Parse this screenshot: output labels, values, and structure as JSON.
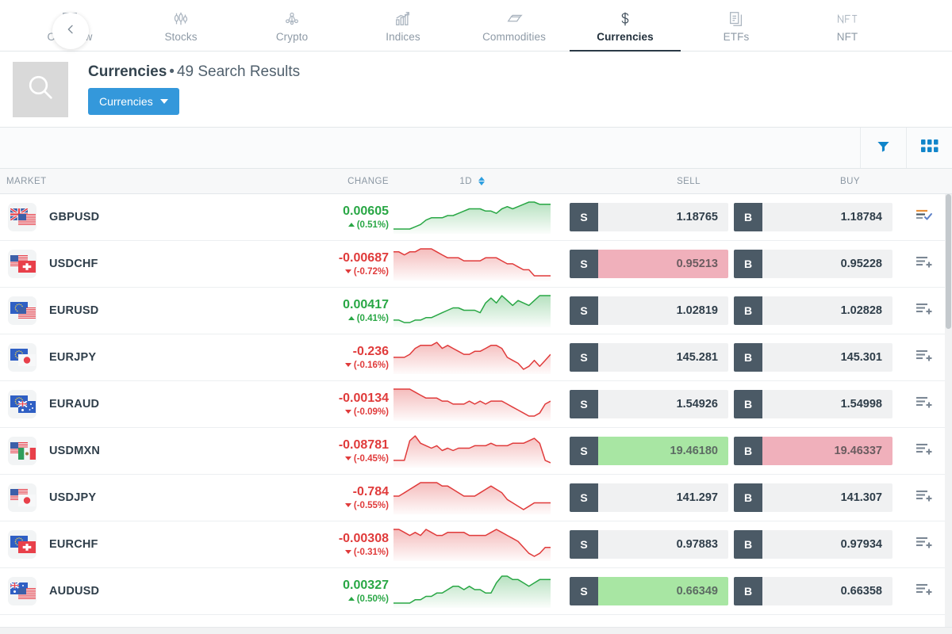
{
  "nav": {
    "back_icon": "chevron-left-icon",
    "tabs": [
      {
        "label": "Overview",
        "icon": "overview-icon",
        "active": false
      },
      {
        "label": "Stocks",
        "icon": "candlestick-icon",
        "active": false
      },
      {
        "label": "Crypto",
        "icon": "crypto-node-icon",
        "active": false
      },
      {
        "label": "Indices",
        "icon": "bar-chart-up-icon",
        "active": false
      },
      {
        "label": "Commodities",
        "icon": "gold-bar-icon",
        "active": false
      },
      {
        "label": "Currencies",
        "icon": "dollar-sign-icon",
        "active": true
      },
      {
        "label": "ETFs",
        "icon": "documents-icon",
        "active": false
      },
      {
        "label": "NFT",
        "icon": "nft-icon",
        "active": false
      }
    ]
  },
  "search": {
    "thumb_icon": "magnifier-icon",
    "title_category": "Currencies",
    "title_separator": "•",
    "title_results": "49 Search Results",
    "dropdown_label": "Currencies",
    "dropdown_icon": "caret-down-icon"
  },
  "toolbar": {
    "filter_icon": "funnel-filter-icon",
    "grid_icon": "grid-view-icon",
    "accent_color": "#1185ca"
  },
  "table": {
    "headers": {
      "market": "MARKET",
      "change": "CHANGE",
      "period": "1D",
      "sell": "SELL",
      "buy": "BUY"
    },
    "sell_tag": "S",
    "buy_tag": "B",
    "sort_icon": "sort-updown-icon",
    "rows": [
      {
        "market": "GBPUSD",
        "flag_a": "gb",
        "flag_b": "us",
        "change": "0.00605",
        "percent": "(0.51%)",
        "direction": "up",
        "spark_dir": "up",
        "spark": [
          14,
          14,
          14,
          14,
          13,
          12,
          10,
          9,
          9,
          9,
          8,
          8,
          7,
          6,
          5,
          5,
          5,
          6,
          6,
          7,
          5,
          4,
          5,
          4,
          3,
          2,
          2,
          3,
          3,
          3
        ],
        "sell": "1.18765",
        "sell_state": "none",
        "buy": "1.18784",
        "buy_state": "none",
        "action_icon": "watchlist-added-icon"
      },
      {
        "market": "USDCHF",
        "flag_a": "us",
        "flag_b": "ch",
        "change": "-0.00687",
        "percent": "(-0.72%)",
        "direction": "down",
        "spark_dir": "down",
        "spark": [
          4,
          4,
          5,
          4,
          4,
          3,
          3,
          3,
          4,
          5,
          6,
          6,
          6,
          7,
          7,
          7,
          7,
          6,
          6,
          6,
          7,
          8,
          8,
          9,
          10,
          10,
          12,
          12,
          12,
          12
        ],
        "sell": "0.95213",
        "sell_state": "red",
        "buy": "0.95228",
        "buy_state": "none",
        "action_icon": "watchlist-add-icon"
      },
      {
        "market": "EURUSD",
        "flag_a": "eu",
        "flag_b": "us",
        "change": "0.00417",
        "percent": "(0.41%)",
        "direction": "up",
        "spark_dir": "up",
        "spark": [
          12,
          12,
          13,
          13,
          12,
          12,
          11,
          11,
          10,
          9,
          8,
          7,
          7,
          8,
          8,
          8,
          9,
          5,
          3,
          5,
          2,
          4,
          6,
          4,
          5,
          6,
          4,
          2,
          2,
          2
        ],
        "sell": "1.02819",
        "sell_state": "none",
        "buy": "1.02828",
        "buy_state": "none",
        "action_icon": "watchlist-add-icon"
      },
      {
        "market": "EURJPY",
        "flag_a": "eu",
        "flag_b": "jp",
        "change": "-0.236",
        "percent": "(-0.16%)",
        "direction": "down",
        "spark_dir": "down",
        "spark": [
          8,
          8,
          8,
          7,
          5,
          4,
          4,
          4,
          3,
          5,
          4,
          5,
          6,
          7,
          7,
          6,
          6,
          5,
          4,
          4,
          5,
          8,
          9,
          10,
          12,
          11,
          9,
          11,
          9,
          7
        ],
        "sell": "145.281",
        "sell_state": "none",
        "buy": "145.301",
        "buy_state": "none",
        "action_icon": "watchlist-add-icon"
      },
      {
        "market": "EURAUD",
        "flag_a": "eu",
        "flag_b": "au",
        "change": "-0.00134",
        "percent": "(-0.09%)",
        "direction": "down",
        "spark_dir": "down",
        "spark": [
          2,
          2,
          2,
          2,
          3,
          4,
          5,
          5,
          5,
          6,
          6,
          7,
          7,
          7,
          6,
          7,
          6,
          7,
          6,
          6,
          6,
          7,
          8,
          9,
          10,
          11,
          11,
          10,
          7,
          6
        ],
        "sell": "1.54926",
        "sell_state": "none",
        "buy": "1.54998",
        "buy_state": "none",
        "action_icon": "watchlist-add-icon"
      },
      {
        "market": "USDMXN",
        "flag_a": "us",
        "flag_b": "mx",
        "change": "-0.08781",
        "percent": "(-0.45%)",
        "direction": "down",
        "spark_dir": "down",
        "spark": [
          12,
          12,
          12,
          4,
          2,
          5,
          6,
          7,
          6,
          8,
          7,
          8,
          7,
          7,
          7,
          6,
          6,
          6,
          5,
          6,
          6,
          6,
          5,
          5,
          5,
          4,
          3,
          5,
          12,
          13
        ],
        "sell": "19.46180",
        "sell_state": "green",
        "buy": "19.46337",
        "buy_state": "red",
        "action_icon": "watchlist-add-icon"
      },
      {
        "market": "USDJPY",
        "flag_a": "us",
        "flag_b": "jp",
        "change": "-0.784",
        "percent": "(-0.55%)",
        "direction": "down",
        "spark_dir": "down",
        "spark": [
          7,
          7,
          6,
          5,
          4,
          3,
          3,
          3,
          3,
          4,
          4,
          5,
          6,
          7,
          7,
          7,
          6,
          5,
          4,
          5,
          6,
          8,
          9,
          10,
          11,
          10,
          9,
          9,
          9,
          9
        ],
        "sell": "141.297",
        "sell_state": "none",
        "buy": "141.307",
        "buy_state": "none",
        "action_icon": "watchlist-add-icon"
      },
      {
        "market": "EURCHF",
        "flag_a": "eu",
        "flag_b": "ch",
        "change": "-0.00308",
        "percent": "(-0.31%)",
        "direction": "down",
        "spark_dir": "down",
        "spark": [
          4,
          4,
          5,
          6,
          5,
          6,
          4,
          5,
          6,
          6,
          5,
          5,
          5,
          5,
          6,
          6,
          6,
          6,
          5,
          4,
          5,
          6,
          7,
          8,
          10,
          12,
          13,
          12,
          10,
          10
        ],
        "sell": "0.97883",
        "sell_state": "none",
        "buy": "0.97934",
        "buy_state": "none",
        "action_icon": "watchlist-add-icon"
      },
      {
        "market": "AUDUSD",
        "flag_a": "au",
        "flag_b": "us",
        "change": "0.00327",
        "percent": "(0.50%)",
        "direction": "up",
        "spark_dir": "up",
        "spark": [
          11,
          11,
          11,
          11,
          10,
          10,
          9,
          9,
          8,
          8,
          7,
          6,
          6,
          7,
          6,
          7,
          7,
          8,
          8,
          5,
          3,
          3,
          4,
          4,
          5,
          6,
          5,
          4,
          4,
          4
        ],
        "sell": "0.66349",
        "sell_state": "green",
        "buy": "0.66358",
        "buy_state": "none",
        "action_icon": "watchlist-add-icon"
      }
    ]
  },
  "colors": {
    "up": "#29a745",
    "down": "#e03b3b",
    "accent": "#3498db",
    "tag": "#4b5a66",
    "hi_green": "#a8e6a3",
    "hi_red": "#f0b0bb"
  }
}
